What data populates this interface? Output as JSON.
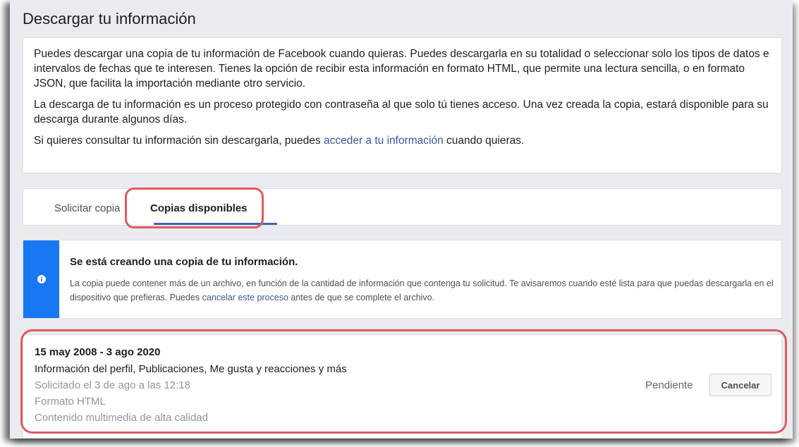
{
  "page": {
    "title": "Descargar tu información"
  },
  "intro": {
    "p1": "Puedes descargar una copia de tu información de Facebook cuando quieras. Puedes descargarla en su totalidad o seleccionar solo los tipos de datos e intervalos de fechas que te interesen. Tienes la opción de recibir esta información en formato HTML, que permite una lectura sencilla, o en formato JSON, que facilita la importación mediante otro servicio.",
    "p2": "La descarga de tu información es un proceso protegido con contraseña al que solo tú tienes acceso. Una vez creada la copia, estará disponible para su descarga durante algunos días.",
    "p3_before": "Si quieres consultar tu información sin descargarla, puedes ",
    "p3_link": "acceder a tu información",
    "p3_after": " cuando quieras."
  },
  "tabs": [
    {
      "label": "Solicitar copia",
      "active": false
    },
    {
      "label": "Copias disponibles",
      "active": true
    }
  ],
  "notice": {
    "icon": "info-icon",
    "title": "Se está creando una copia de tu información.",
    "body_before": "La copia puede contener más de un archivo, en función de la cantidad de información que contenga tu solicitud. Te avisaremos cuando esté lista para que puedas descargarla en el dispositivo que prefieras. Puedes ",
    "body_link": "cancelar este proceso",
    "body_after": " antes de que se complete el archivo."
  },
  "request": {
    "dates": "15 may 2008 - 3 ago 2020",
    "types": "Información del perfil, Publicaciones, Me gusta y reacciones y más",
    "requested": "Solicitado el 3 de ago a las 12:18",
    "format": "Formato HTML",
    "media": "Contenido multimedia de alta calidad",
    "status": "Pendiente",
    "cancel_label": "Cancelar"
  },
  "colors": {
    "accent": "#4267b2",
    "link": "#385898",
    "notice_stripe": "#1877f2",
    "highlight": "#e05a61"
  }
}
